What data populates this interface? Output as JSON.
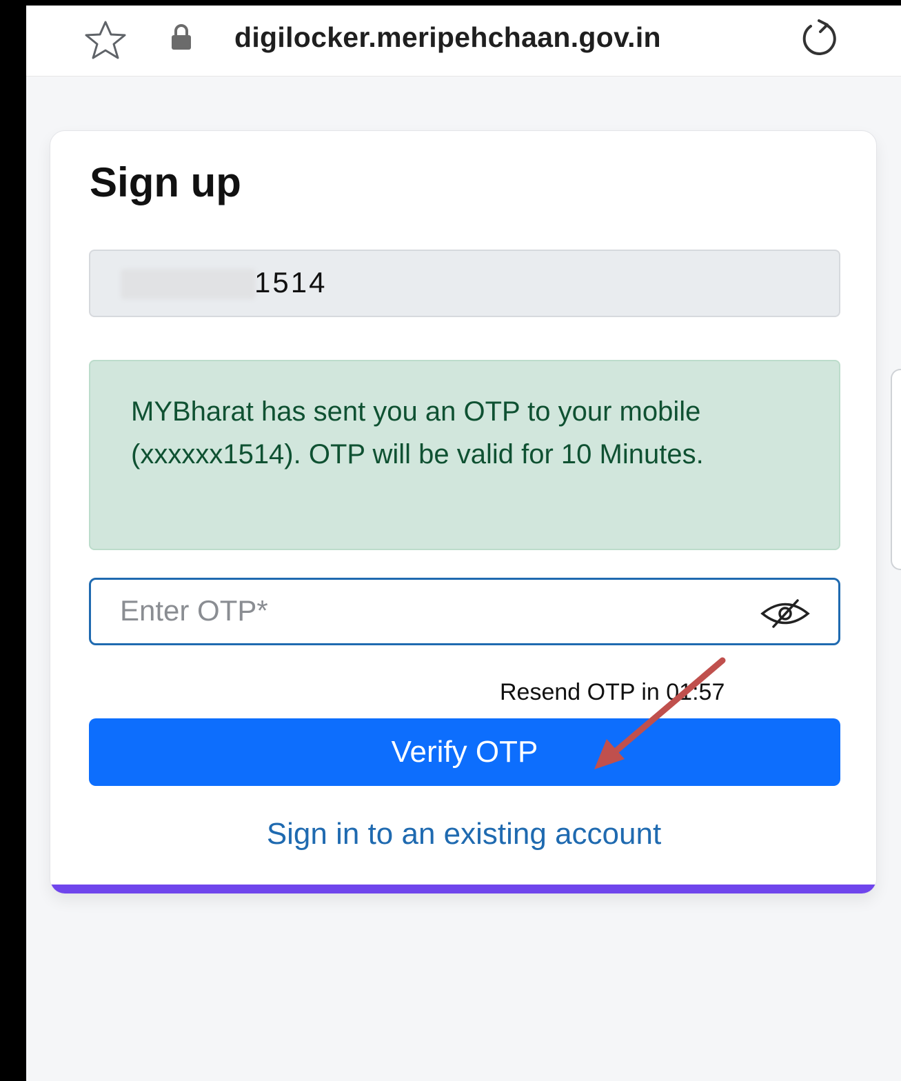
{
  "browser": {
    "url": "digilocker.meripehchaan.gov.in",
    "icons": [
      "star-icon",
      "lock-icon",
      "reload-icon"
    ]
  },
  "signup": {
    "title": "Sign up",
    "phone_value": "1514",
    "alert_message": "MYBharat has sent you an OTP to your mobile (xxxxxx1514). OTP will be valid for 10 Minutes.",
    "otp_placeholder": "Enter OTP*",
    "otp_value": "",
    "resend_text": "Resend OTP in  01:57",
    "verify_button": "Verify OTP",
    "signin_link": "Sign in to an existing account"
  },
  "colors": {
    "primary_button": "#0d6efd",
    "link": "#1f6ab0",
    "alert_bg": "#d1e6dc",
    "alert_text": "#0f5132",
    "card_accent": "#6f45ec",
    "annotation_arrow": "#c0504d"
  }
}
